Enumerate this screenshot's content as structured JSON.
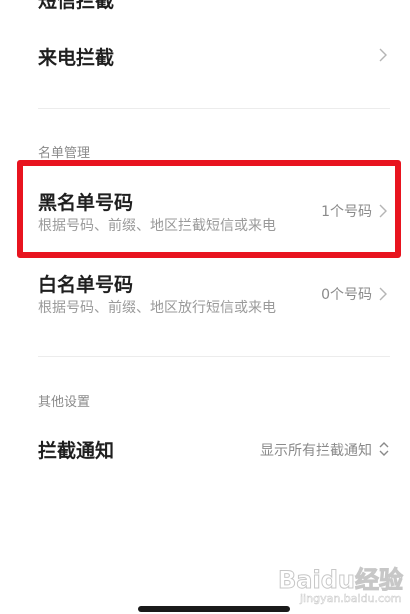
{
  "top_cut": {
    "title": "短信拦截"
  },
  "call_block": {
    "title": "来电拦截"
  },
  "list_section": {
    "label": "名单管理"
  },
  "blacklist": {
    "title": "黑名单号码",
    "subtitle": "根据号码、前缀、地区拦截短信或来电",
    "count": "1个号码"
  },
  "whitelist": {
    "title": "白名单号码",
    "subtitle": "根据号码、前缀、地区放行短信或来电",
    "count": "0个号码"
  },
  "other_section": {
    "label": "其他设置"
  },
  "block_notify": {
    "title": "拦截通知",
    "value": "显示所有拦截通知"
  },
  "watermark": {
    "brand": "Baidu经验",
    "domain": "jingyan.baidu.com"
  },
  "colors": {
    "highlight": "#e8141f",
    "primary_text": "#1f1f1f",
    "secondary_text": "#9a9a9a"
  }
}
